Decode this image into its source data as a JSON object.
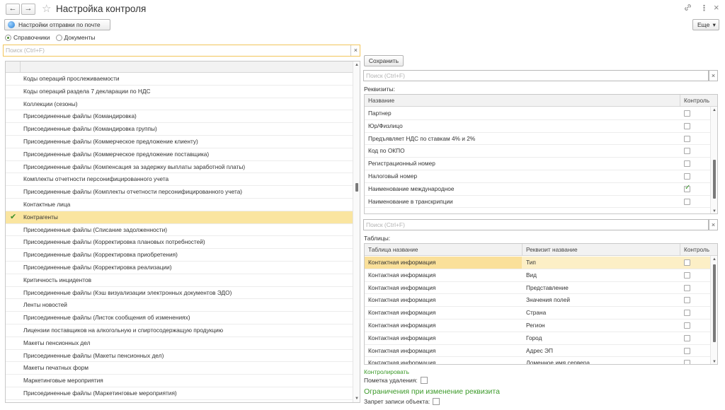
{
  "window": {
    "title": "Настройка контроля",
    "back_icon": "←",
    "forward_icon": "→",
    "star_icon": "☆",
    "link_icon": "🔗",
    "menu_icon": "⋮",
    "close_icon": "×"
  },
  "toolbar": {
    "mail_settings_label": "Настройки отправки по почте",
    "more_label": "Еще",
    "more_arrow": "▾"
  },
  "mode": {
    "options": [
      "Справочники",
      "Документы"
    ],
    "selected": "Справочники"
  },
  "left_search": {
    "placeholder": "Поиск (Ctrl+F)",
    "clear": "×"
  },
  "left_list": {
    "items": [
      {
        "label": "Коды операций прослеживаемости",
        "checked": false
      },
      {
        "label": "Коды операций раздела 7 декларации по НДС",
        "checked": false
      },
      {
        "label": "Коллекции (сезоны)",
        "checked": false
      },
      {
        "label": "Присоединенные файлы (Командировка)",
        "checked": false
      },
      {
        "label": "Присоединенные файлы (Командировка группы)",
        "checked": false
      },
      {
        "label": "Присоединенные файлы (Коммерческое предложение клиенту)",
        "checked": false
      },
      {
        "label": "Присоединенные файлы (Коммерческое предложение поставщика)",
        "checked": false
      },
      {
        "label": "Присоединенные файлы (Компенсация за задержку выплаты заработной платы)",
        "checked": false
      },
      {
        "label": "Комплекты отчетности персонифицированного учета",
        "checked": false
      },
      {
        "label": "Присоединенные файлы (Комплекты отчетности персонифицированного учета)",
        "checked": false
      },
      {
        "label": "Контактные лица",
        "checked": false
      },
      {
        "label": "Контрагенты",
        "checked": true,
        "selected": true
      },
      {
        "label": "Присоединенные файлы (Списание задолженности)",
        "checked": false
      },
      {
        "label": "Присоединенные файлы (Корректировка плановых потребностей)",
        "checked": false
      },
      {
        "label": "Присоединенные файлы (Корректировка приобретения)",
        "checked": false
      },
      {
        "label": "Присоединенные файлы (Корректировка реализации)",
        "checked": false
      },
      {
        "label": "Критичность инцидентов",
        "checked": false
      },
      {
        "label": "Присоединенные файлы (Кэш визуализации электронных документов ЭДО)",
        "checked": false
      },
      {
        "label": "Ленты новостей",
        "checked": false
      },
      {
        "label": "Присоединенные файлы (Листок сообщения об изменениях)",
        "checked": false
      },
      {
        "label": "Лицензии поставщиков на алкогольную и спиртосодержащую продукцию",
        "checked": false
      },
      {
        "label": "Макеты пенсионных дел",
        "checked": false
      },
      {
        "label": "Присоединенные файлы (Макеты пенсионных дел)",
        "checked": false
      },
      {
        "label": "Макеты печатных форм",
        "checked": false
      },
      {
        "label": "Маркетинговые мероприятия",
        "checked": false
      },
      {
        "label": "Присоединенные файлы (Маркетинговые мероприятия)",
        "checked": false
      }
    ],
    "check_icon": "✔"
  },
  "right": {
    "save_label": "Сохранить",
    "req_search": {
      "placeholder": "Поиск (Ctrl+F)",
      "clear": "×"
    },
    "requisites_label": "Реквизиты:",
    "requisites": {
      "headers": [
        "Название",
        "Контроль"
      ],
      "rows": [
        {
          "name": "Партнер",
          "control": false
        },
        {
          "name": "Юр/Физлицо",
          "control": false
        },
        {
          "name": "Предъявляет НДС по ставкам 4% и 2%",
          "control": false
        },
        {
          "name": "Код по ОКПО",
          "control": false
        },
        {
          "name": "Регистрационный номер",
          "control": false
        },
        {
          "name": "Налоговый номер",
          "control": false
        },
        {
          "name": "Наименование международное",
          "control": true
        },
        {
          "name": "Наименование в транскрипции",
          "control": false
        }
      ]
    },
    "tab_search": {
      "placeholder": "Поиск (Ctrl+F)",
      "clear": "×"
    },
    "tables_label": "Таблицы:",
    "tables": {
      "headers": [
        "Таблица название",
        "Реквизит название",
        "Контроль"
      ],
      "rows": [
        {
          "table": "Контактная информация",
          "req": "Тип",
          "control": false
        },
        {
          "table": "Контактная информация",
          "req": "Вид",
          "control": false
        },
        {
          "table": "Контактная информация",
          "req": "Представление",
          "control": false
        },
        {
          "table": "Контактная информация",
          "req": "Значения полей",
          "control": false
        },
        {
          "table": "Контактная информация",
          "req": "Страна",
          "control": false
        },
        {
          "table": "Контактная информация",
          "req": "Регион",
          "control": false
        },
        {
          "table": "Контактная информация",
          "req": "Город",
          "control": false
        },
        {
          "table": "Контактная информация",
          "req": "Адрес ЭП",
          "control": false
        },
        {
          "table": "Контактная информация",
          "req": "Доменное имя сервера",
          "control": false
        }
      ]
    },
    "control_link": "Контролировать",
    "deletion_mark_label": "Пометка удаления:",
    "restrictions_title": "Ограничения при изменение реквизита",
    "write_ban_label": "Запрет записи объекта:"
  },
  "colors": {
    "selected_row": "#fae5a0",
    "accent_green": "#3c9a2a",
    "search_focus": "#f2c55a"
  }
}
